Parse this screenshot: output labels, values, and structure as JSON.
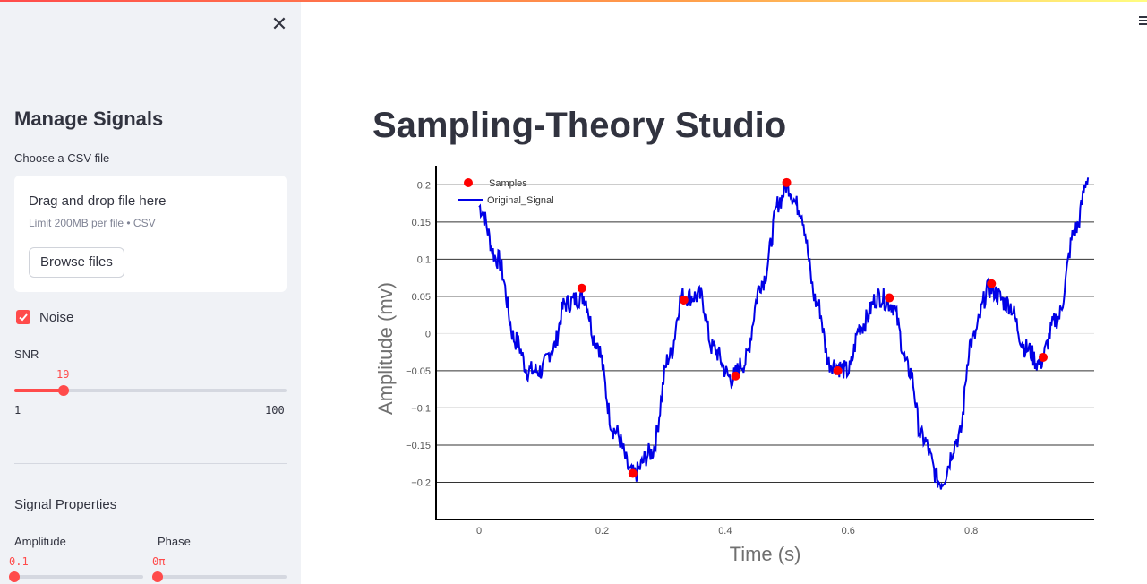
{
  "sidebar": {
    "title": "Manage Signals",
    "uploader": {
      "label": "Choose a CSV file",
      "drop_text": "Drag and drop file here",
      "limit_text": "Limit 200MB per file • CSV",
      "browse_label": "Browse files"
    },
    "noise": {
      "label": "Noise",
      "checked": true
    },
    "snr": {
      "label": "SNR",
      "value": 19,
      "min": 1,
      "max": 100,
      "value_text": "19",
      "min_text": "1",
      "max_text": "100"
    },
    "properties_title": "Signal Properties",
    "amplitude": {
      "label": "Amplitude",
      "value_text": "0.1",
      "value": 0.1
    },
    "phase": {
      "label": "Phase",
      "value_text": "0π",
      "value": 0
    }
  },
  "main": {
    "title": "Sampling-Theory Studio"
  },
  "colors": {
    "accent": "#ff4b4b",
    "signal": "#0000e6",
    "samples": "#ff0000"
  },
  "chart_data": {
    "type": "line",
    "xlabel": "Time (s)",
    "ylabel": "Amplitude (mv)",
    "xlim": [
      -0.07,
      1.0
    ],
    "ylim": [
      -0.25,
      0.21
    ],
    "x_ticks": [
      0,
      0.2,
      0.4,
      0.6,
      0.8
    ],
    "x_tick_labels": [
      "0",
      "0.2",
      "0.4",
      "0.6",
      "0.8"
    ],
    "y_ticks": [
      -0.2,
      -0.15,
      -0.1,
      -0.05,
      0,
      0.05,
      0.1,
      0.15,
      0.2
    ],
    "y_tick_labels": [
      "−0.2",
      "−0.15",
      "−0.1",
      "−0.05",
      "0",
      "0.05",
      "0.1",
      "0.15",
      "0.2"
    ],
    "legend": {
      "placement": "top-left",
      "entries": [
        "Samples",
        "Original_Signal"
      ]
    },
    "series": [
      {
        "name": "Original_Signal",
        "x": [
          0.0,
          0.03,
          0.06,
          0.08,
          0.1,
          0.12,
          0.14,
          0.17,
          0.19,
          0.22,
          0.25,
          0.28,
          0.31,
          0.33,
          0.36,
          0.38,
          0.41,
          0.43,
          0.46,
          0.49,
          0.5,
          0.52,
          0.55,
          0.57,
          0.6,
          0.62,
          0.65,
          0.67,
          0.7,
          0.72,
          0.75,
          0.78,
          0.8,
          0.83,
          0.86,
          0.89,
          0.91,
          0.94,
          0.97,
          0.99
        ],
        "y": [
          0.17,
          0.1,
          -0.01,
          -0.05,
          -0.05,
          -0.02,
          0.04,
          0.05,
          -0.01,
          -0.13,
          -0.19,
          -0.16,
          -0.03,
          0.05,
          0.05,
          -0.02,
          -0.06,
          -0.04,
          0.07,
          0.18,
          0.2,
          0.17,
          0.04,
          -0.04,
          -0.05,
          0.01,
          0.05,
          0.04,
          -0.05,
          -0.14,
          -0.2,
          -0.14,
          -0.01,
          0.06,
          0.04,
          -0.02,
          -0.04,
          0.02,
          0.14,
          0.21
        ]
      },
      {
        "name": "Samples",
        "x": [
          0.167,
          0.25,
          0.333,
          0.417,
          0.5,
          0.583,
          0.667,
          0.833,
          0.917
        ],
        "y": [
          0.061,
          -0.188,
          0.045,
          -0.057,
          0.203,
          -0.05,
          0.048,
          0.067,
          -0.032
        ]
      }
    ]
  }
}
